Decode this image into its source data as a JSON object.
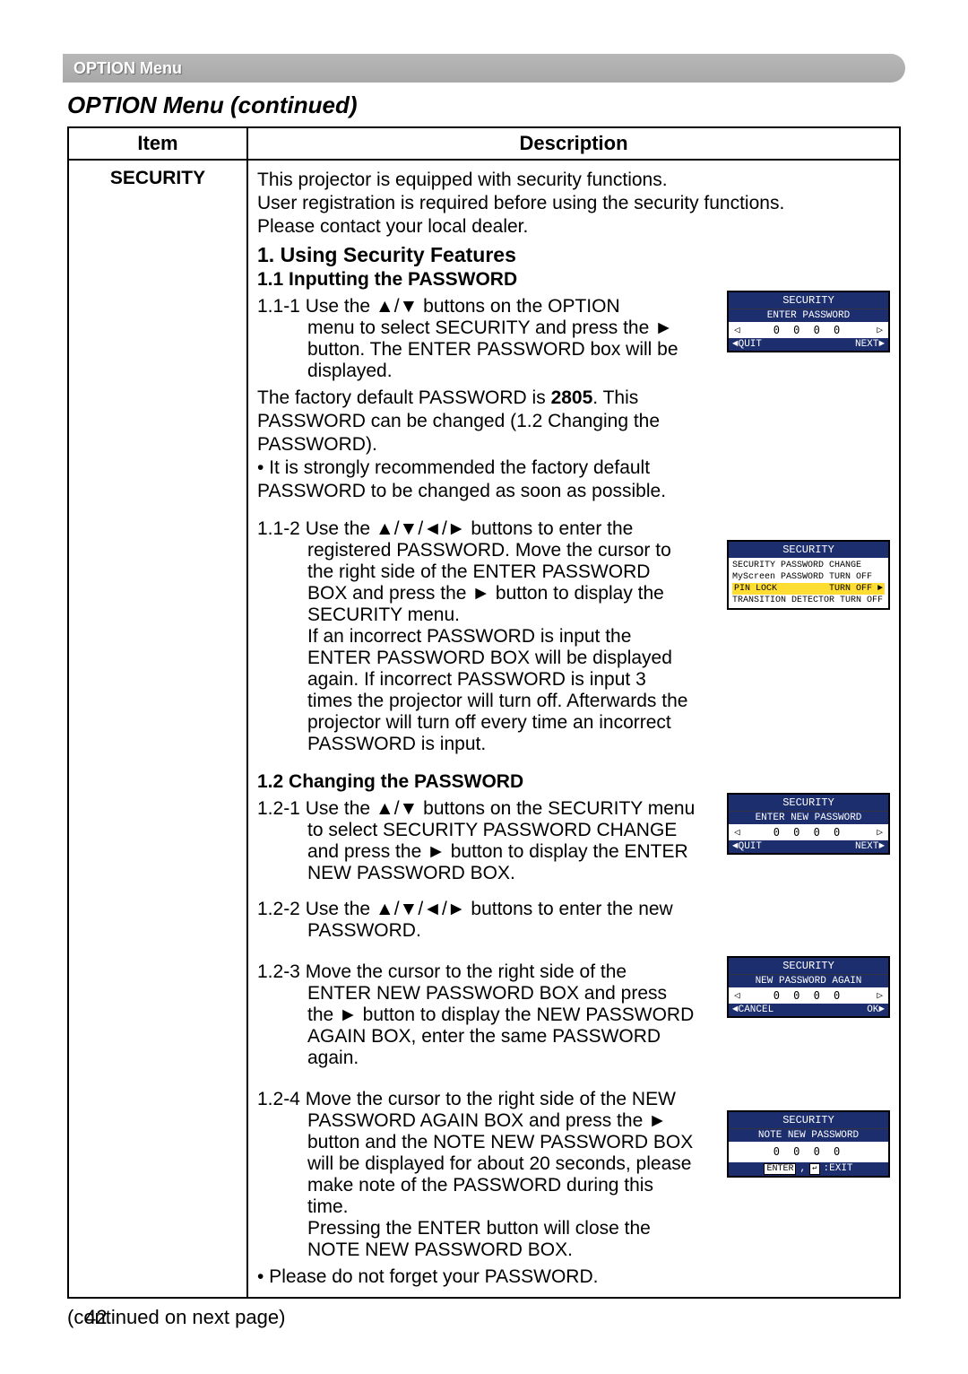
{
  "header_bar": "OPTION Menu",
  "subtitle": "OPTION Menu (continued)",
  "table": {
    "col_item": "Item",
    "col_desc": "Description"
  },
  "item_name": "SECURITY",
  "intro": {
    "l1": "This projector is equipped with security functions.",
    "l2": "User registration is required before using the security functions.",
    "l3": "Please contact your local dealer."
  },
  "h1": "1. Using Security Features",
  "h2_11": "1.1 Inputting the PASSWORD",
  "s111": {
    "num": "1.1-1",
    "t1": "Use the ▲/▼ buttons on the OPTION",
    "t2": "menu to select SECURITY and press the ►",
    "t3": "button. The ENTER PASSWORD box will be",
    "t4": "displayed.",
    "after1": "The factory default PASSWORD is ",
    "bold": "2805",
    "after1b": ". This",
    "after2": "PASSWORD can be changed (1.2 Changing the",
    "after3": "PASSWORD).",
    "bullet1": "• It is strongly recommended the factory default",
    "bullet2": "PASSWORD to be changed as soon as possible."
  },
  "s112": {
    "num": "1.1-2",
    "t1": "Use the ▲/▼/◄/► buttons to enter the",
    "t2": "registered PASSWORD. Move the cursor to",
    "t3": "the right side of the ENTER PASSWORD",
    "t4": "BOX and press the ► button to display the",
    "t5": "SECURITY menu.",
    "t6": "If an incorrect PASSWORD is input the",
    "t7": "ENTER PASSWORD BOX will be displayed",
    "t8": "again. If incorrect PASSWORD is input 3",
    "t9": "times the projector will turn off. Afterwards the",
    "t10": "projector will turn off every time an incorrect",
    "t11": "PASSWORD is input."
  },
  "h2_12": "1.2 Changing the PASSWORD",
  "s121": {
    "num": "1.2-1",
    "t1": "Use the ▲/▼ buttons on the SECURITY menu",
    "t2": "to select SECURITY PASSWORD CHANGE",
    "t3": "and press the ► button to display the ENTER",
    "t4": "NEW PASSWORD BOX."
  },
  "s122": {
    "num": "1.2-2",
    "t1": "Use the ▲/▼/◄/► buttons to enter the new",
    "t2": "PASSWORD."
  },
  "s123": {
    "num": "1.2-3",
    "t1": "Move the cursor to the right side of the",
    "t2": "ENTER NEW PASSWORD BOX and press",
    "t3": "the ► button to display the NEW PASSWORD",
    "t4": "AGAIN BOX, enter the same PASSWORD",
    "t5": "again."
  },
  "s124": {
    "num": "1.2-4",
    "t1": "Move the cursor to the right side of the NEW",
    "t2": "PASSWORD AGAIN BOX and press the ►",
    "t3": "button and the NOTE NEW PASSWORD BOX",
    "t4": "will be displayed for about 20 seconds, please",
    "t5": "make note of the PASSWORD during this",
    "t6": "time.",
    "t7": "Pressing the ENTER button will close the",
    "t8": "NOTE NEW PASSWORD BOX.",
    "bullet": "• Please do not forget your PASSWORD."
  },
  "osd1": {
    "title": "SECURITY",
    "sub": "ENTER PASSWORD",
    "digits": "0  0  0  0",
    "quit": "◄QUIT",
    "next": "NEXT►",
    "la": "◁",
    "ra": "▷"
  },
  "osd2": {
    "title": "SECURITY",
    "r1": "SECURITY PASSWORD CHANGE",
    "r2": "MyScreen PASSWORD TURN OFF",
    "r3a": "PIN LOCK",
    "r3b": "TURN OFF ►",
    "r4": "TRANSITION DETECTOR TURN OFF"
  },
  "osd3": {
    "title": "SECURITY",
    "sub": "ENTER NEW PASSWORD",
    "digits": "0  0  0  0",
    "quit": "◄QUIT",
    "next": "NEXT►",
    "la": "◁",
    "ra": "▷"
  },
  "osd4": {
    "title": "SECURITY",
    "sub": "NEW PASSWORD AGAIN",
    "digits": "0  0  0  0",
    "quit": "◄CANCEL",
    "next": "OK►",
    "la": "◁",
    "ra": "▷"
  },
  "osd5": {
    "title": "SECURITY",
    "sub": "NOTE NEW PASSWORD",
    "digits": "0  0  0  0",
    "enter": "ENTER",
    "reset": "↩",
    "exit": ":EXIT"
  },
  "continued": "(continued on next page)",
  "page": "42"
}
